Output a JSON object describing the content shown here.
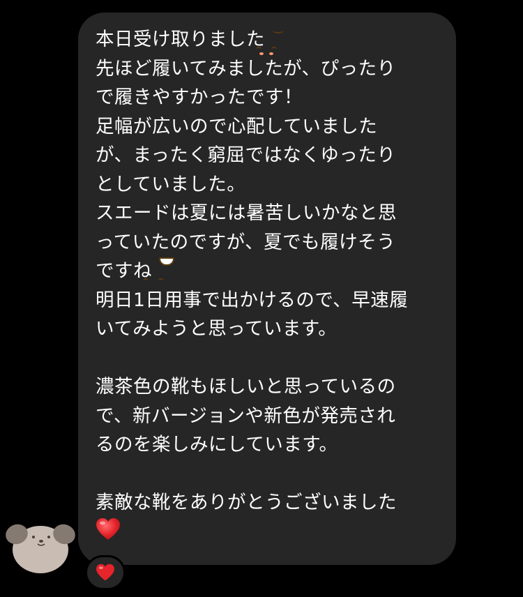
{
  "message": {
    "lines": [
      "本日受け取りました",
      "先ほど履いてみましたが、ぴったり",
      "で履きやすかったです！",
      "足幅が広いので心配していました",
      "が、まったく窮屈ではなくゆったり",
      "としていました。",
      "スエードは夏には暑苦しいかなと思",
      "っていたのですが、夏でも履けそう",
      "ですね",
      "明日1日用事で出かけるので、早速履",
      "いてみようと思っています。",
      "",
      "濃茶色の靴もほしいと思っているの",
      "で、新バージョンや新色が発売され",
      "るのを楽しみにしています。",
      "",
      "素敵な靴をありがとうございました"
    ],
    "emojis": {
      "line1": "smiling-face-emoji",
      "line9": "grinning-face-emoji",
      "end": "red-heart-emoji"
    },
    "reaction": "red-heart-emoji"
  },
  "colors": {
    "background": "#000000",
    "bubble": "#262626",
    "text": "#ffffff",
    "heart": "#e5242b",
    "avatar": "#c9bcb3"
  }
}
